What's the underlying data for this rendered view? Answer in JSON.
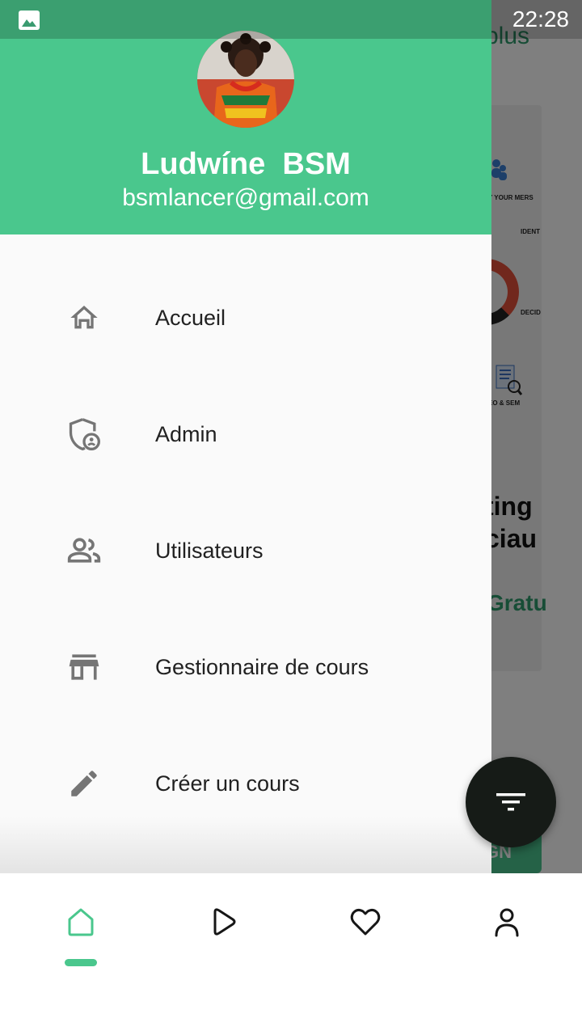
{
  "status_bar": {
    "time": "22:28",
    "icon": "image-icon"
  },
  "background": {
    "app_title": "plus",
    "card_snippets": {
      "customers": "Y YOUR\nMERS",
      "identify": "IDENT\nCOMI",
      "decide": "DECID",
      "seo": "EO & SEM"
    },
    "headline_line1": "ting",
    "headline_line2": "ciau",
    "price_text": "Gratu",
    "button_text": "GN"
  },
  "drawer": {
    "user": {
      "name": "Ludwíne  BSM",
      "email": "bsmlancer@gmail.com"
    },
    "menu": [
      {
        "label": "Accueil",
        "icon": "home-icon"
      },
      {
        "label": "Admin",
        "icon": "admin-shield-icon"
      },
      {
        "label": "Utilisateurs",
        "icon": "users-icon"
      },
      {
        "label": "Gestionnaire de cours",
        "icon": "store-icon"
      },
      {
        "label": "Créer un cours",
        "icon": "pencil-icon"
      }
    ]
  },
  "fab": {
    "icon": "filter-icon"
  },
  "bottom_nav": {
    "items": [
      {
        "icon": "home-icon",
        "active": true
      },
      {
        "icon": "play-icon",
        "active": false
      },
      {
        "icon": "heart-icon",
        "active": false
      },
      {
        "icon": "profile-icon",
        "active": false
      }
    ]
  },
  "colors": {
    "accent": "#4ac78d",
    "fab": "#161b17",
    "text": "#212121",
    "icon": "#757575"
  }
}
